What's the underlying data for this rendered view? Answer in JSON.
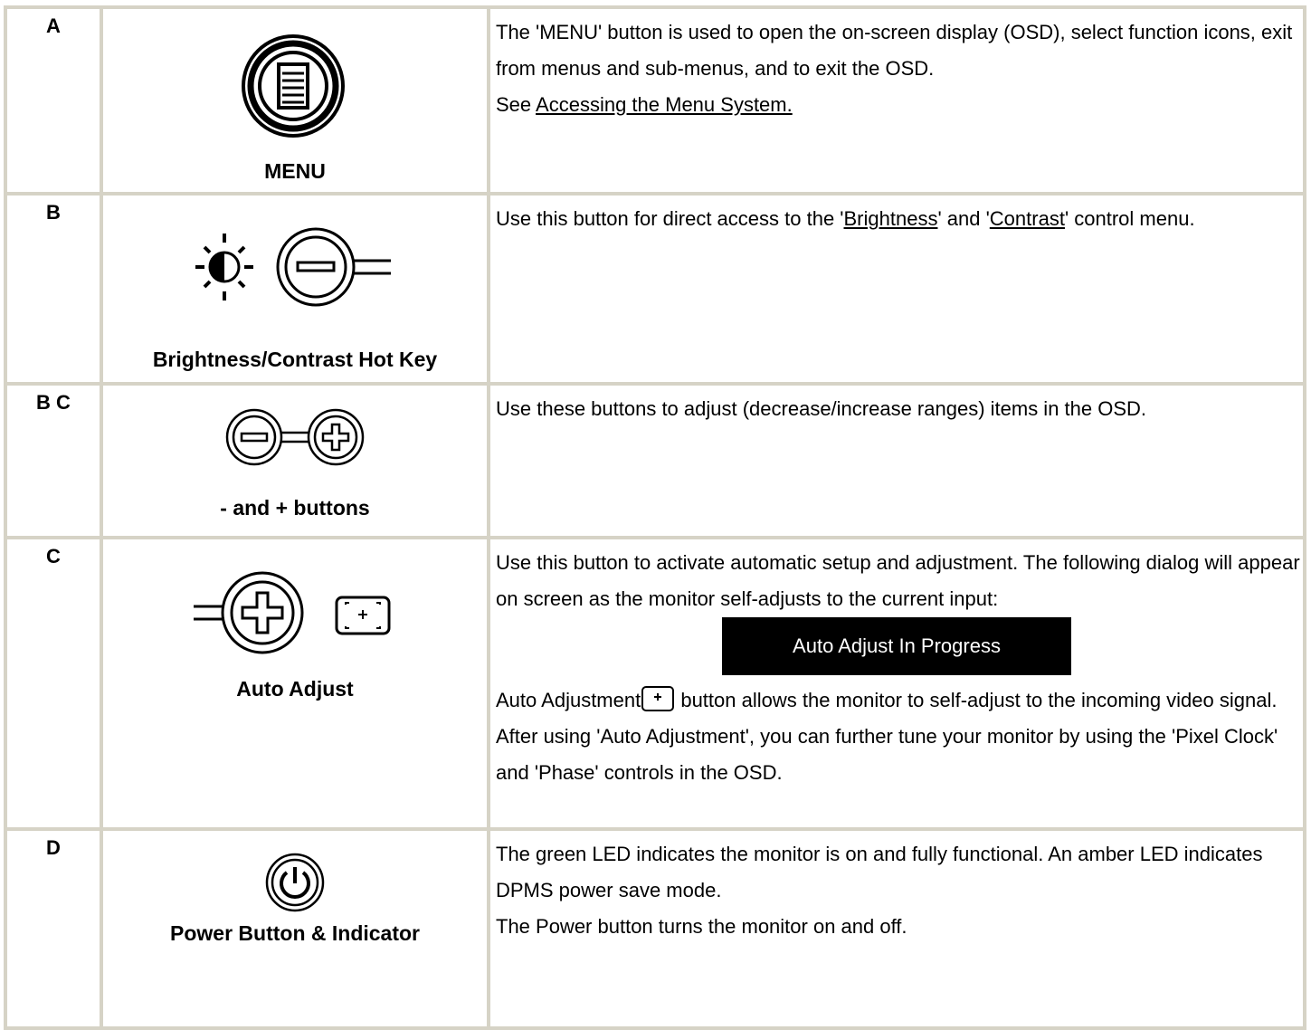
{
  "rows": [
    {
      "letter": "A",
      "caption": "MENU",
      "icon": "menu-button-icon",
      "text1": "The 'MENU' button is used to open the on-screen display (OSD), select function icons, exit from menus and sub-menus, and to exit the OSD.",
      "see_prefix": "See ",
      "link": "Accessing the Menu System."
    },
    {
      "letter": "B",
      "caption": "Brightness/Contrast Hot Key",
      "icon": "brightness-minus-icon",
      "text_a": "Use this button for direct access to the '",
      "link1": "Brightness",
      "text_b": "' and '",
      "link2": "Contrast",
      "text_c": "' control menu."
    },
    {
      "letter": "B C",
      "caption": "- and + buttons",
      "icon": "minus-plus-buttons-icon",
      "text": "Use these buttons to adjust (decrease/increase ranges) items in the OSD."
    },
    {
      "letter": "C",
      "caption": "Auto Adjust",
      "icon": "plus-auto-adjust-icon",
      "text1": "Use this button to activate automatic setup and adjustment. The following dialog will appear on screen as the monitor self-adjusts to the current input:",
      "osd_label": "Auto Adjust In Progress",
      "text2a": "Auto Adjustment",
      "text2b": " button allows the monitor to self-adjust to the incoming video signal. After using 'Auto Adjustment', you can further tune your monitor by using the 'Pixel Clock' and 'Phase' controls in the OSD."
    },
    {
      "letter": "D",
      "caption": "Power Button & Indicator",
      "icon": "power-button-icon",
      "text1": "The green LED indicates the monitor is on and fully functional. An amber LED indicates DPMS power save mode.",
      "text2": "The Power button turns the monitor on and off."
    }
  ]
}
